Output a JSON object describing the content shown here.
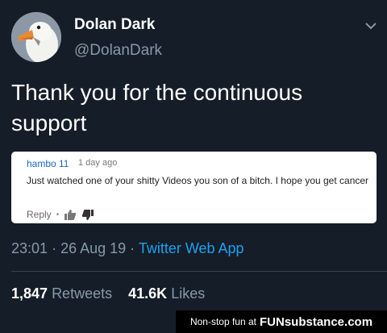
{
  "tweet": {
    "display_name": "Dolan Dark",
    "handle": "@DolanDark",
    "text": "Thank you for the continuous support",
    "time": "23:01",
    "date": "26 Aug 19",
    "via": "Twitter Web App",
    "retweets_count": "1,847",
    "retweets_label": "Retweets",
    "likes_count": "41.6K",
    "likes_label": "Likes"
  },
  "embed": {
    "username": "hambo 11",
    "time_ago": "1 day ago",
    "comment": "Just watched one of your shitty Videos you son of a bitch. I hope you get cancer",
    "reply_label": "Reply"
  },
  "watermark": {
    "prefix": "Non-stop fun at",
    "brand": "FUNsubstance.com"
  },
  "icons": {
    "avatar": "goose-avatar",
    "menu": "chevron-down-icon",
    "like": "thumbs-up-icon",
    "dislike": "thumbs-down-icon"
  },
  "colors": {
    "background": "#151d28",
    "secondary_text": "#8899a6",
    "link": "#1da1f2",
    "embed_username": "#1a66c8"
  }
}
